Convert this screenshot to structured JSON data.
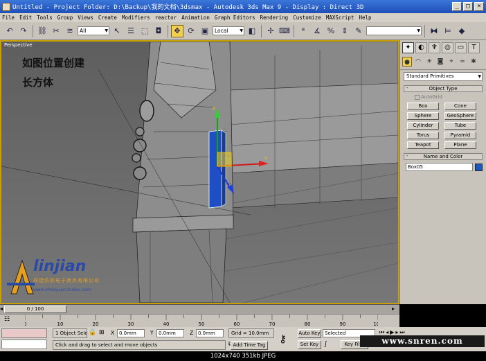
{
  "window": {
    "title": "Untitled    - Project Folder: D:\\Backup\\我的文档\\3dsmax    - Autodesk 3ds Max 9    - Display : Direct 3D"
  },
  "menu": [
    "File",
    "Edit",
    "Tools",
    "Group",
    "Views",
    "Create",
    "Modifiers",
    "reactor",
    "Animation",
    "Graph Editors",
    "Rendering",
    "Customize",
    "MAXScript",
    "Help"
  ],
  "toolbar": {
    "selection_filter": "All",
    "reference_coord": "Local"
  },
  "viewport": {
    "label": "Perspective",
    "note_line1": "如图位置创建",
    "note_line2": "长方体",
    "brand_name": "linjian",
    "brand_sub": "林建纺织电子商务有限公司",
    "brand_url": "www.zhenjuan.fudeo.com"
  },
  "command_panel": {
    "dropdown": "Standard Primitives",
    "object_type_title": "Object Type",
    "autogrid_label": "AutoGrid",
    "buttons": [
      "Box",
      "Cone",
      "Sphere",
      "GeoSphere",
      "Cylinder",
      "Tube",
      "Torus",
      "Pyramid",
      "Teapot",
      "Plane"
    ],
    "name_color_title": "Name and Color",
    "object_name": "Box05",
    "object_color": "#1c58c0"
  },
  "timeline": {
    "frame_display": "0 / 100",
    "ticks": [
      "0",
      "10",
      "20",
      "30",
      "40",
      "50",
      "60",
      "70",
      "80",
      "90",
      "100"
    ]
  },
  "status": {
    "selection": "1 Object Sele",
    "x_label": "X",
    "x_value": "0.0mm",
    "y_label": "Y",
    "y_value": "0.0mm",
    "z_label": "Z",
    "z_value": "0.0mm",
    "grid": "Grid = 10.0mm",
    "prompt": "Click and drag to select and move objects",
    "add_time_tag": "Add Time Tag",
    "auto_key": "Auto Key",
    "set_key": "Set Key",
    "selected": "Selected",
    "key_filters": "Key Filte"
  },
  "watermark": "www.snren.com",
  "image_info": "1024x740  351kb  JPEG"
}
